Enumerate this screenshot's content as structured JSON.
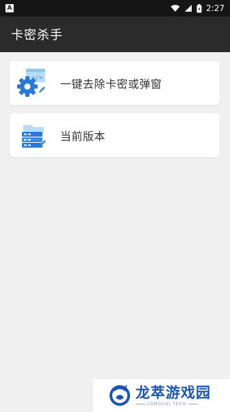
{
  "status_bar": {
    "notification_icon": "A",
    "time": "2:27"
  },
  "app_bar": {
    "title": "卡密杀手"
  },
  "menu": {
    "items": [
      {
        "label": "一键去除卡密或弹窗",
        "icon": "gear-code-icon"
      },
      {
        "label": "当前版本",
        "icon": "server-stack-icon"
      }
    ]
  },
  "watermark": {
    "name": "龙萃游戏园",
    "subtitle": "LONGCUI TECH",
    "color": "#1a56b8"
  }
}
